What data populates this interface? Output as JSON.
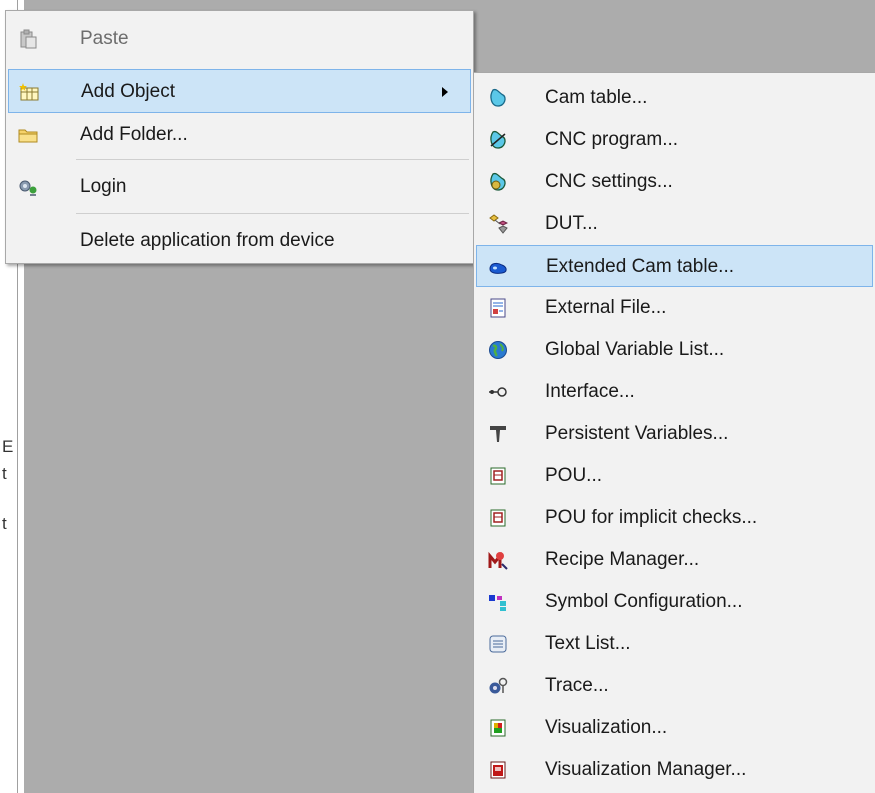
{
  "context_menu": {
    "items": [
      {
        "label": "Paste",
        "enabled": false,
        "icon": "paste-icon"
      },
      {
        "label": "Add Object",
        "enabled": true,
        "highlighted": true,
        "has_submenu": true,
        "icon": "add-object-icon"
      },
      {
        "label": "Add Folder...",
        "enabled": true,
        "icon": "folder-icon"
      },
      {
        "label": "Login",
        "enabled": true,
        "icon": "login-icon"
      },
      {
        "label": "Delete application from device",
        "enabled": true
      }
    ]
  },
  "submenu": {
    "items": [
      {
        "label": "Cam table...",
        "icon": "cam-table-icon"
      },
      {
        "label": "CNC program...",
        "icon": "cnc-program-icon"
      },
      {
        "label": "CNC settings...",
        "icon": "cnc-settings-icon"
      },
      {
        "label": "DUT...",
        "icon": "dut-icon"
      },
      {
        "label": "Extended Cam table...",
        "icon": "extended-cam-table-icon",
        "highlighted": true
      },
      {
        "label": "External File...",
        "icon": "external-file-icon"
      },
      {
        "label": "Global Variable List...",
        "icon": "globe-icon"
      },
      {
        "label": "Interface...",
        "icon": "interface-icon"
      },
      {
        "label": "Persistent Variables...",
        "icon": "persistent-variables-icon"
      },
      {
        "label": "POU...",
        "icon": "pou-icon"
      },
      {
        "label": "POU for implicit checks...",
        "icon": "pou-implicit-checks-icon"
      },
      {
        "label": "Recipe Manager...",
        "icon": "recipe-manager-icon"
      },
      {
        "label": "Symbol Configuration...",
        "icon": "symbol-configuration-icon"
      },
      {
        "label": "Text List...",
        "icon": "text-list-icon"
      },
      {
        "label": "Trace...",
        "icon": "trace-icon"
      },
      {
        "label": "Visualization...",
        "icon": "visualization-icon"
      },
      {
        "label": "Visualization Manager...",
        "icon": "visualization-manager-icon"
      }
    ]
  },
  "background_fragments": [
    "E",
    "t",
    "t"
  ],
  "colors": {
    "menu_bg": "#f2f2f2",
    "highlight_bg": "#cce4f7",
    "highlight_border": "#7eb4ea",
    "workspace_bg": "#acacac",
    "disabled_text": "#6d6d6d"
  }
}
